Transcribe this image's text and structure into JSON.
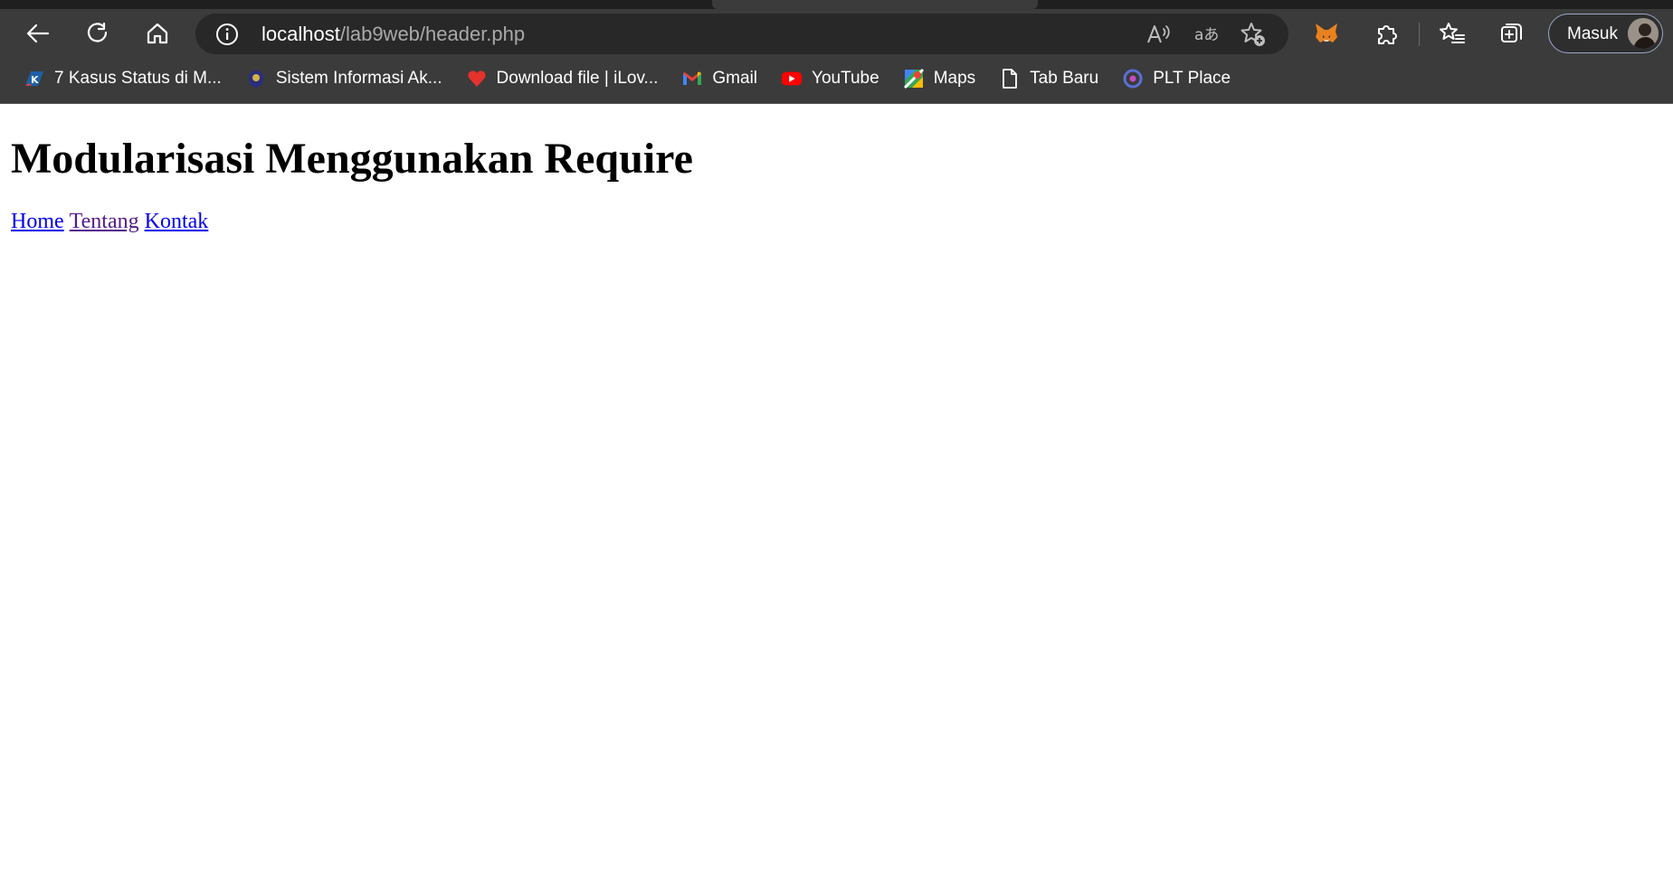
{
  "browser": {
    "address_bar": {
      "host": "localhost",
      "path": "/lab9web/header.php"
    },
    "profile_label": "Masuk",
    "icons": {
      "back": "back-arrow-icon",
      "refresh": "refresh-icon",
      "home": "home-icon",
      "site_info": "info-icon",
      "read_aloud": "read-aloud-icon",
      "translate": "translate-icon",
      "add_favorite": "add-favorite-icon",
      "metamask": "fox-extension-icon",
      "extensions": "puzzle-icon",
      "favorites": "favorites-list-icon",
      "collections": "collections-icon"
    },
    "bookmarks": [
      {
        "label": "7 Kasus Status di M...",
        "icon": "k-logo-icon"
      },
      {
        "label": "Sistem Informasi Ak...",
        "icon": "university-seal-icon"
      },
      {
        "label": "Download file | iLov...",
        "icon": "heart-icon"
      },
      {
        "label": "Gmail",
        "icon": "gmail-icon"
      },
      {
        "label": "YouTube",
        "icon": "youtube-icon"
      },
      {
        "label": "Maps",
        "icon": "maps-icon"
      },
      {
        "label": "Tab Baru",
        "icon": "page-icon"
      },
      {
        "label": "PLT Place",
        "icon": "plt-icon"
      }
    ]
  },
  "page": {
    "title": "Modularisasi Menggunakan Require",
    "nav": [
      {
        "label": "Home",
        "state": "unvisited"
      },
      {
        "label": "Tentang",
        "state": "visited"
      },
      {
        "label": "Kontak",
        "state": "unvisited"
      }
    ]
  },
  "colors": {
    "chrome_bg": "#3b3b3b",
    "address_bg": "#282828",
    "link_unvisited": "#0000ee",
    "link_visited": "#551a8b"
  }
}
